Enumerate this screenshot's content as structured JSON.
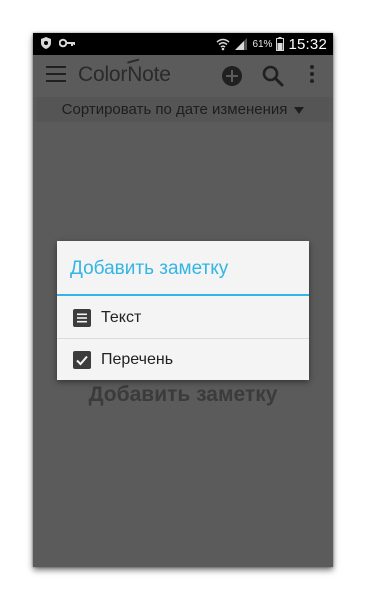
{
  "status_bar": {
    "battery_percent": "61%",
    "time": "15:32"
  },
  "toolbar": {
    "app_title_pre": "Color",
    "app_title_n": "N",
    "app_title_post": "ote"
  },
  "sort": {
    "label": "Сортировать по дате изменения"
  },
  "empty_state": {
    "text": "Добавить заметку"
  },
  "dialog": {
    "title": "Добавить заметку",
    "accent_color": "#33b5e5",
    "items": [
      {
        "label": "Текст",
        "icon": "text-note-icon"
      },
      {
        "label": "Перечень",
        "icon": "checklist-icon"
      }
    ]
  }
}
